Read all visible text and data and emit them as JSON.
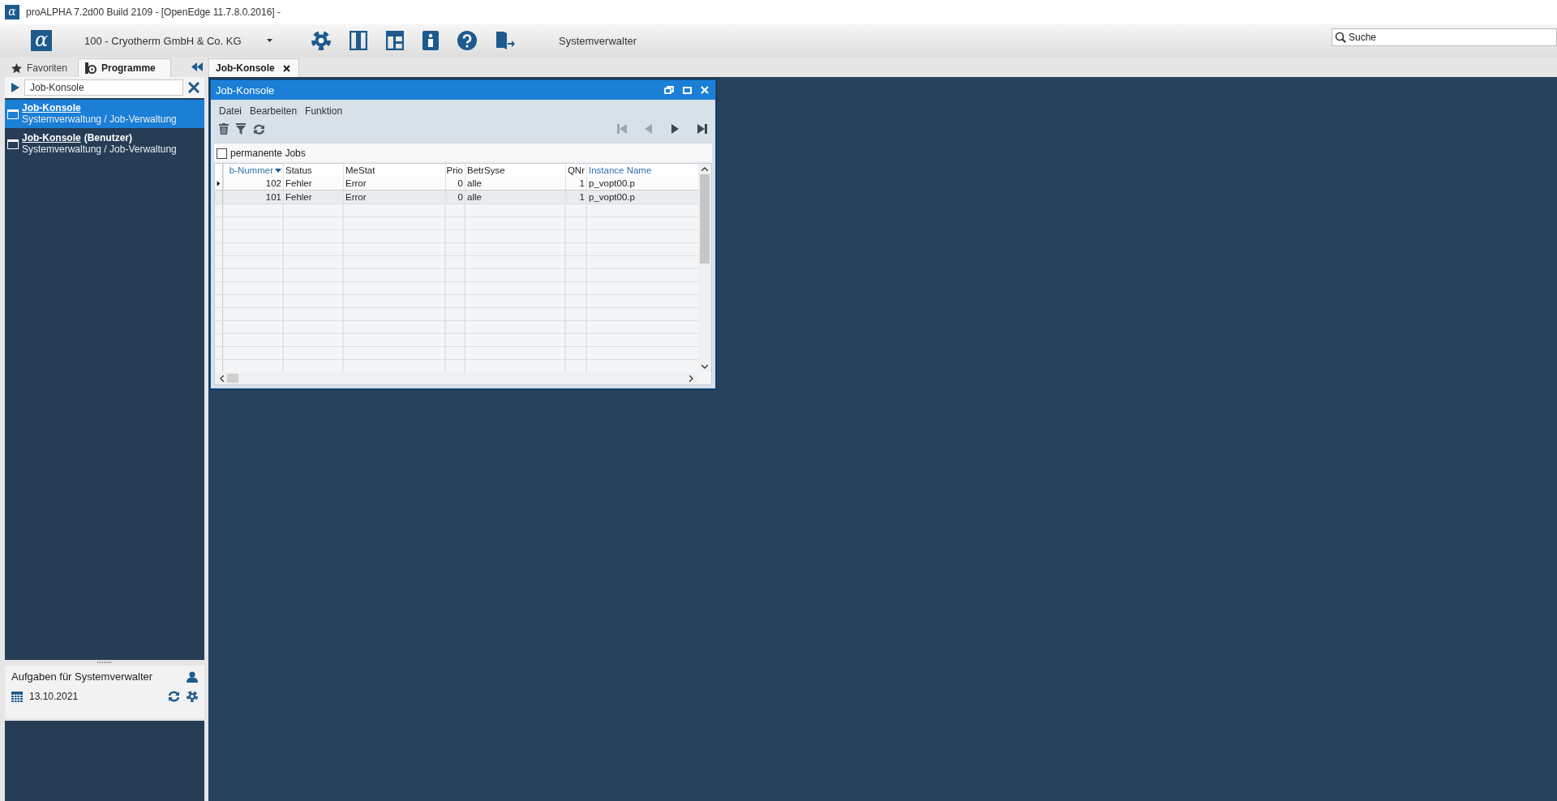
{
  "window": {
    "title": "proALPHA 7.2d00 Build 2109 - [OpenEdge 11.7.8.0.2016] -",
    "logo": "α"
  },
  "toolbar": {
    "logo": "α",
    "company": "100 - Cryotherm GmbH & Co. KG",
    "user": "Systemverwalter",
    "search": {
      "placeholder": "Suche"
    }
  },
  "sidebar": {
    "tabs": [
      {
        "label": "Favoriten",
        "selected": false
      },
      {
        "label": "Programme",
        "selected": true
      }
    ],
    "search": {
      "value": "Job-Konsole"
    },
    "items": [
      {
        "title": "Job-Konsole",
        "path": "Systemverwaltung / Job-Verwaltung",
        "selected": true
      },
      {
        "title": "Job-Konsole",
        "suffix": "(Benutzer)",
        "path": "Systemverwaltung / Job-Verwaltung",
        "selected": false
      }
    ],
    "tasks": {
      "title": "Aufgaben für Systemverwalter",
      "date": "13.10.2021"
    }
  },
  "document_tabs": [
    {
      "label": "Job-Konsole",
      "selected": true
    }
  ],
  "job_window": {
    "title": "Job-Konsole",
    "menu": [
      "Datei",
      "Bearbeiten",
      "Funktion"
    ],
    "nav_buttons": [
      {
        "kind": "first",
        "disabled": true
      },
      {
        "kind": "prev",
        "disabled": true
      },
      {
        "kind": "next",
        "disabled": false
      },
      {
        "kind": "last",
        "disabled": false
      }
    ],
    "permanent_jobs": {
      "label": "permanente Jobs",
      "checked": false
    },
    "table": {
      "columns": [
        {
          "label": "b-Nummer",
          "sorted": true,
          "emphasis": true
        },
        {
          "label": "Status",
          "sorted": false,
          "emphasis": false
        },
        {
          "label": "MeStat",
          "sorted": false,
          "emphasis": false
        },
        {
          "label": "Prio",
          "sorted": false,
          "emphasis": false
        },
        {
          "label": "BetrSyse",
          "sorted": false,
          "emphasis": false
        },
        {
          "label": "QNr",
          "sorted": false,
          "emphasis": false
        },
        {
          "label": "Instance Name",
          "sorted": false,
          "emphasis": true
        }
      ],
      "rows": [
        {
          "cells": [
            "102",
            "Fehler",
            "Error",
            "0",
            "alle",
            "1",
            "p_vopt00.p"
          ],
          "selected": true
        },
        {
          "cells": [
            "101",
            "Fehler",
            "Error",
            "0",
            "alle",
            "1",
            "p_vopt00.p"
          ],
          "selected": false
        }
      ]
    }
  }
}
